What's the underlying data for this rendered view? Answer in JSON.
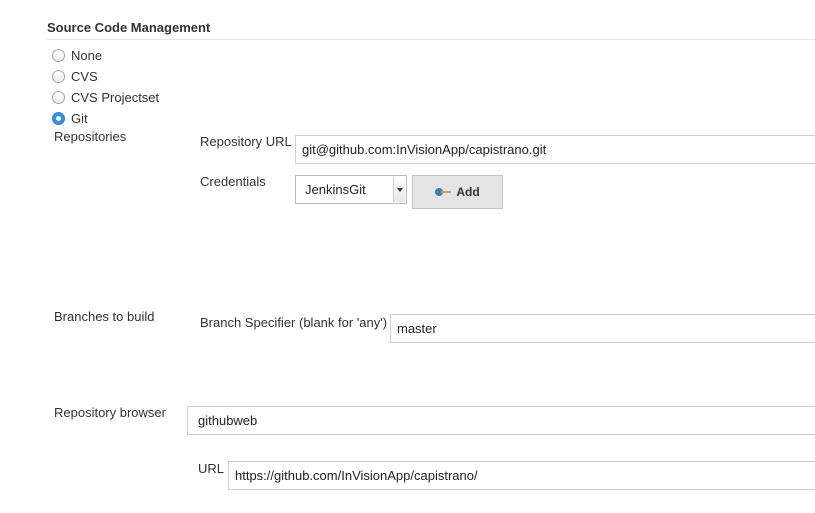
{
  "section": {
    "title": "Source Code Management"
  },
  "scm_options": [
    {
      "label": "None",
      "checked": false
    },
    {
      "label": "CVS",
      "checked": false
    },
    {
      "label": "CVS Projectset",
      "checked": false
    },
    {
      "label": "Git",
      "checked": true
    }
  ],
  "repositories": {
    "label": "Repositories",
    "url_label": "Repository URL",
    "url_value": "git@github.com:InVisionApp/capistrano.git",
    "credentials_label": "Credentials",
    "credentials_value": "JenkinsGit",
    "add_label": "Add"
  },
  "branches": {
    "label": "Branches to build",
    "specifier_label": "Branch Specifier (blank for 'any')",
    "specifier_value": "master"
  },
  "browser": {
    "label": "Repository browser",
    "value": "githubweb",
    "url_label": "URL",
    "url_value": "https://github.com/InVisionApp/capistrano/"
  },
  "colors": {
    "accent": "#3d8ee6",
    "border": "#cfcfcf",
    "button_bg": "#e4e4e4"
  }
}
